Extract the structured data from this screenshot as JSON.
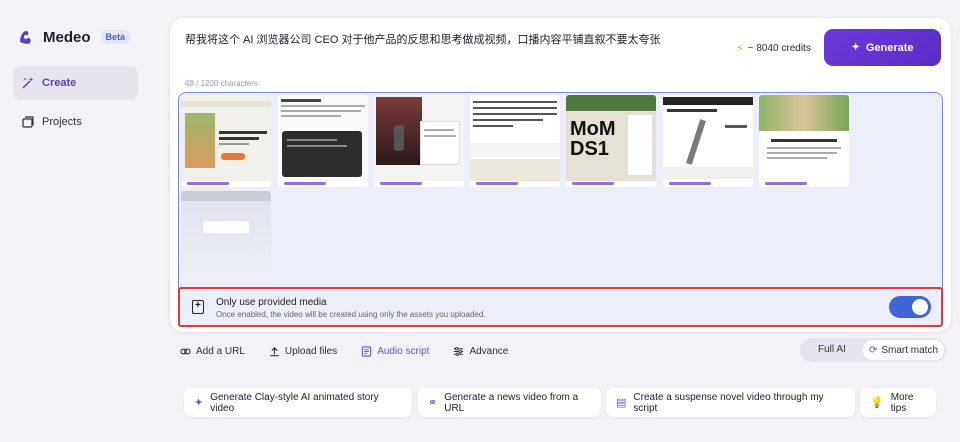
{
  "brand": {
    "name": "Medeo",
    "badge": "Beta"
  },
  "sidebar": {
    "items": [
      {
        "label": "Create",
        "icon": "magic-wand-icon",
        "active": true
      },
      {
        "label": "Projects",
        "icon": "stack-icon",
        "active": false
      }
    ]
  },
  "prompt": {
    "text": "帮我将这个 AI 浏览器公司 CEO 对于他产品的反思和思考做成视频，口播内容平铺直叙不要太夸张",
    "char_count": "48 / 1200 characters"
  },
  "credits": {
    "label": "~ 8040 credits",
    "icon": "bolt-icon"
  },
  "generate_button": {
    "label": "Generate",
    "icon": "sparkle-icon"
  },
  "media": {
    "thumbnails": [
      {
        "name": "thumb-1",
        "caption": "Danforth: Make a Salad with Me"
      },
      {
        "name": "thumb-2",
        "caption": "AI browser in a playground"
      },
      {
        "name": "thumb-3",
        "caption": ""
      },
      {
        "name": "thumb-4",
        "caption": ""
      },
      {
        "name": "thumb-5",
        "caption": "MoM DS1"
      },
      {
        "name": "thumb-6",
        "caption": ""
      },
      {
        "name": "thumb-7",
        "caption": "The Best Make a Salad with Me"
      },
      {
        "name": "thumb-8",
        "caption": ""
      }
    ]
  },
  "media_toggle": {
    "title": "Only use provided media",
    "subtitle": "Once enabled, the video will be created using only the assets you uploaded.",
    "enabled": true
  },
  "toolbar": {
    "add_url": "Add a URL",
    "upload": "Upload files",
    "audio_script": "Audio script",
    "advance": "Advance"
  },
  "mode": {
    "full_ai": "Full AI",
    "smart_match": "Smart match",
    "selected": "Smart match"
  },
  "suggestions": [
    {
      "label": "Generate Clay-style AI animated story video",
      "icon": "sparkle-icon"
    },
    {
      "label": "Generate a news video from a URL",
      "icon": "link-icon"
    },
    {
      "label": "Create a suspense novel video through my script",
      "icon": "document-icon"
    },
    {
      "label": "More tips",
      "icon": "lightbulb-icon"
    }
  ],
  "colors": {
    "accent": "#6b3bd9",
    "highlight_border": "#e03a3a",
    "toggle_on": "#3f66d6",
    "media_area_bg": "#eceef9"
  }
}
